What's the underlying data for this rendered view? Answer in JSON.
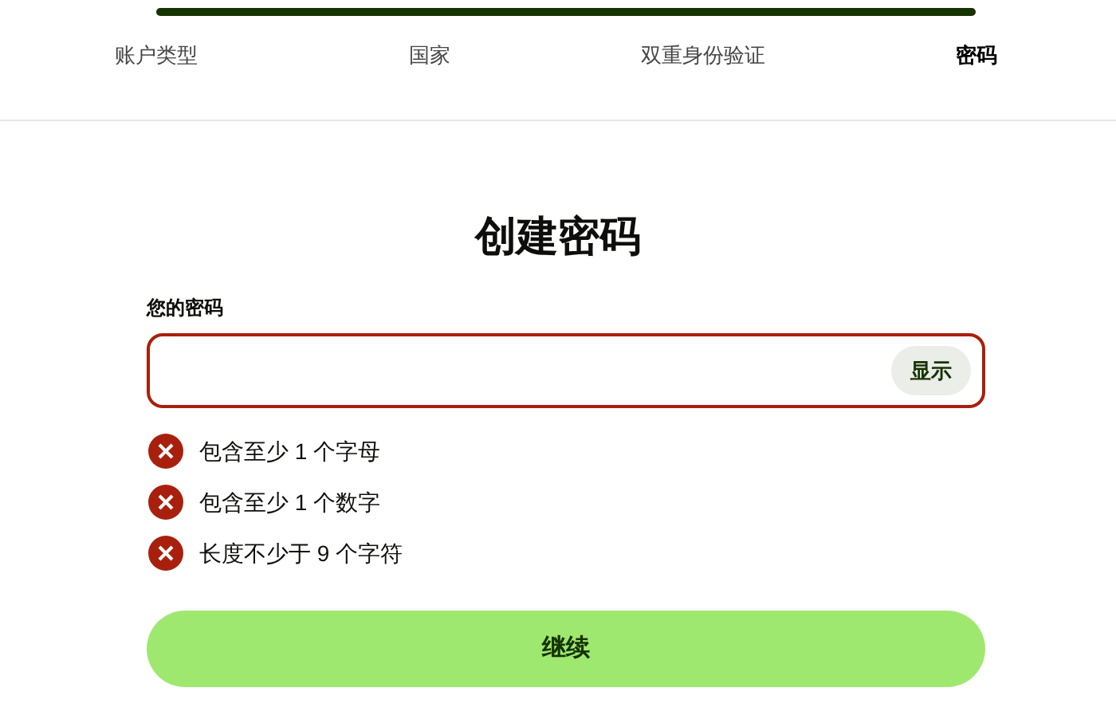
{
  "progress": {
    "level": 1
  },
  "steps": [
    {
      "label": "账户类型",
      "selected": false
    },
    {
      "label": "国家",
      "selected": false
    },
    {
      "label": "双重身份验证",
      "selected": false
    },
    {
      "label": "密码",
      "selected": true
    }
  ],
  "title": "创建密码",
  "password_field": {
    "label": "您的密码",
    "show_button": "显示",
    "error": true
  },
  "requirements": [
    {
      "text": "包含至少 1 个字母",
      "met": false
    },
    {
      "text": "包含至少 1 个数字",
      "met": false
    },
    {
      "text": "长度不少于 9 个字符",
      "met": false
    }
  ],
  "continue_button": "继续"
}
